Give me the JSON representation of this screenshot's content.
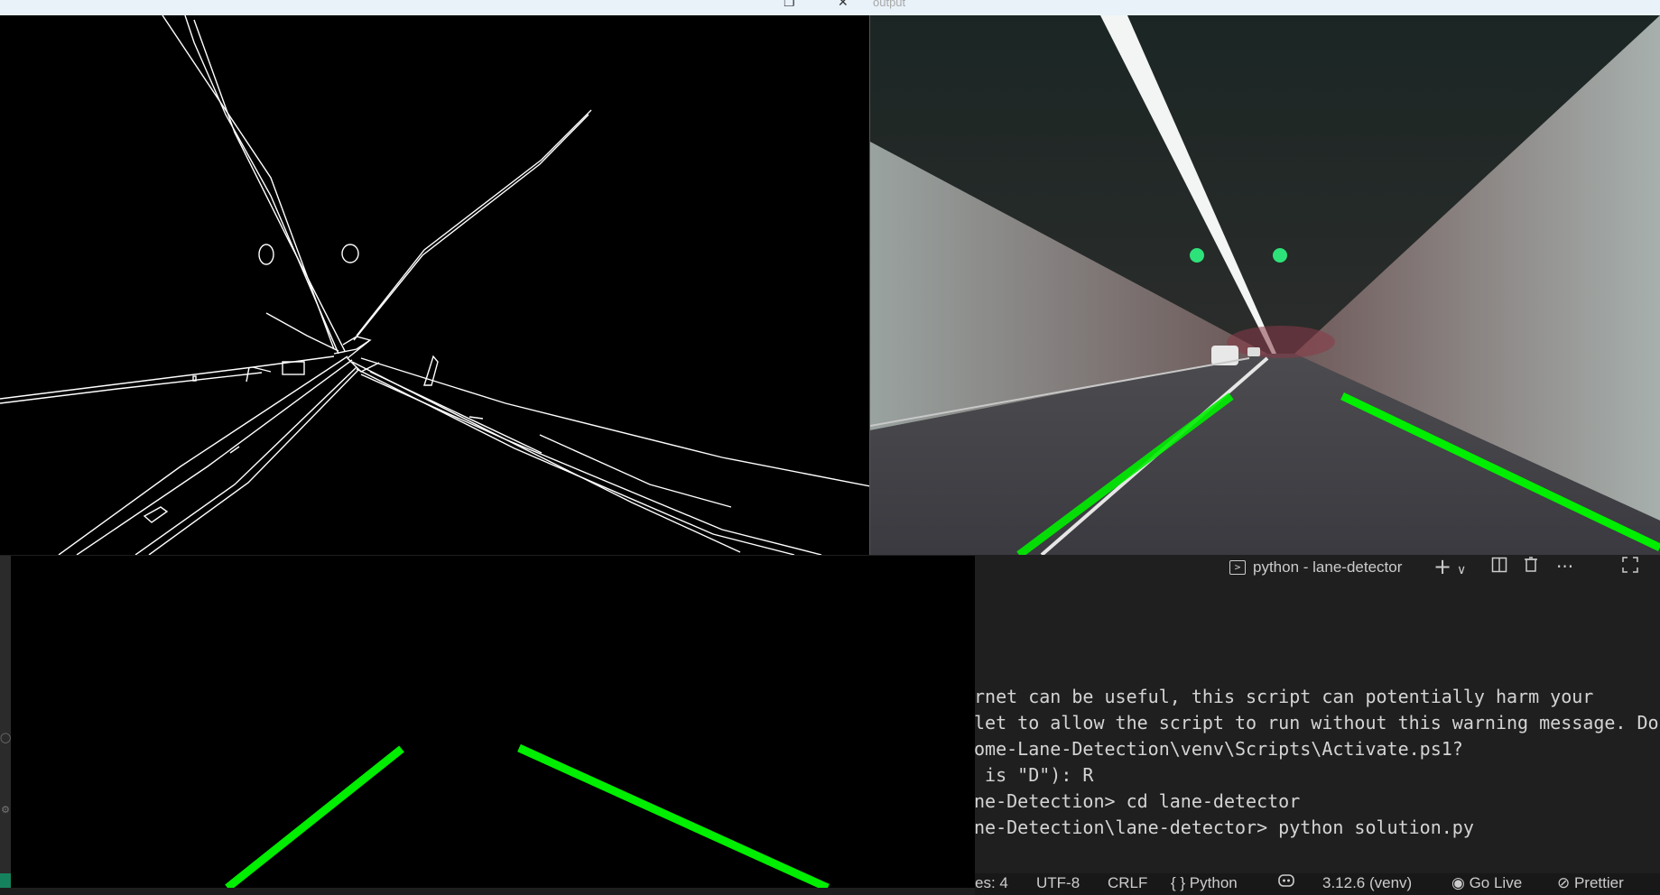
{
  "window": {
    "output_title": "output",
    "buttons": {
      "restore_glyph": "❐",
      "close_glyph": "✕"
    }
  },
  "panes": {
    "edges": {
      "name": "canny-edges-window"
    },
    "output": {
      "name": "lane-detection-output"
    },
    "lines": {
      "name": "hough-lines-window",
      "line_color": "#00ee00"
    }
  },
  "terminal": {
    "tab_label": "python - lane-detector",
    "tab_icon": "terminal-icon",
    "toolbar": {
      "new_glyph": "+",
      "dropdown_glyph": "∨",
      "split_icon": "split-icon",
      "trash_icon": "trash-icon",
      "more_glyph": "···",
      "maximize_icon": "maximize-icon"
    },
    "lines": [
      "rnet can be useful, this script can potentially harm your",
      "let to allow the script to run without this warning message. Do",
      "ome-Lane-Detection\\venv\\Scripts\\Activate.ps1?",
      " is \"D\"): R",
      "ne-Detection> cd lane-detector",
      "ne-Detection\\lane-detector> python solution.py"
    ]
  },
  "statusbar": {
    "spaces": "es: 4",
    "encoding": "UTF-8",
    "eol": "CRLF",
    "language": "{ } Python",
    "copilot_icon": "copilot-icon",
    "interpreter": "3.12.6 (venv)",
    "go_live": "Go Live",
    "prettier": "Prettier"
  },
  "colors": {
    "lane_green": "#00ee00",
    "terminal_bg": "#1f1f1f",
    "titlebar_bg": "#e9f2f9"
  }
}
